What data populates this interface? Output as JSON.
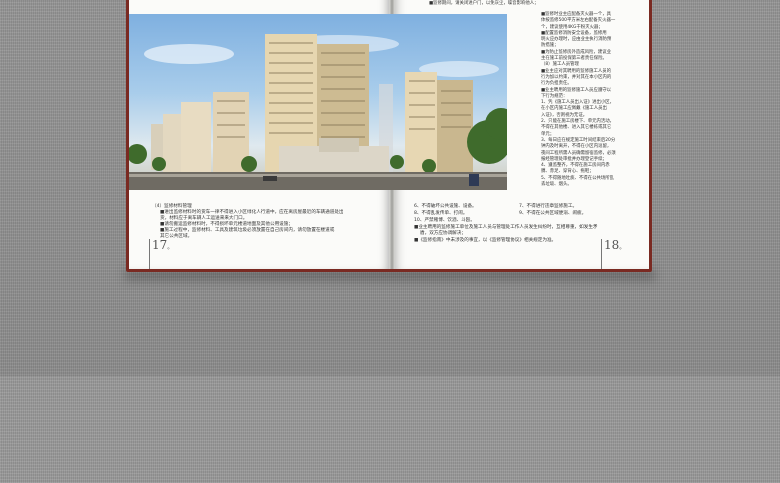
{
  "colors": {
    "cover": "#7a2a22",
    "page": "#fbfbf9",
    "background": "#8e8e8e"
  },
  "photo": {
    "icon": "residential-buildings-rendering"
  },
  "right_top_line": "■监修期间，请关闭进户门，以免灰尘，噪音影响他人；",
  "right_column": [
    "■监修时业主应配备灭火器一个，具",
    "体按监修500平方米左右配备灭火器一",
    "个，建议使用4KG干粉灭火器；",
    "■配置监修消防安全设备，监修用",
    "明火应办理时，应由业主执行消防预",
    "防措施；",
    "■为防止监修房外造成风险，建议业",
    "主在施工前投保第三者责任保险。",
    "（8）施工人员管理",
    "■业主应对其聘用的监修施工人员的",
    "行为加以约束，并对其在本小区内的",
    "行为负担责任。",
    "■业主聘用的监修施工人员应遵守以",
    "下行为规范：",
    "1、凭《施工人员出入证》进出小区，",
    "在小区内施工应佩戴《施工人员出",
    "入证》，否则视为无证。",
    "2、只能在施工房楼下、单元内活动，",
    "不得在其他楼、进入其它楼栋或其它",
    "单元；",
    "3、每日应在规定施工时间结束后20分",
    "钟内及时离开，不得在小区内逗留，",
    "夜间工程所需人员确需留宿监修，必须",
    "报经管理处审批并办理登记手续；",
    "4、遵监整齐，不得在施工房间内赤",
    "膊、赤足、穿背心、拖鞋；",
    "5、不得随地吐痰、不得在公共场所乱",
    "丢垃圾、烟头。"
  ],
  "left_caption": [
    "（4）监修材料管理",
    "■进出监修材料时的货车一律不得进入小区绿化人行道中，应在离房屋最近的车辆通道处出",
    "货，材料应于离车辆人工运送来来大门口。",
    "■请勿搬运监修材料时，不得损坏单元楼道地面及其他公用设施；",
    "■施工过程中，监修材料、工具及建筑垃圾必须放置在自己房间内，请勿放置在楼道或",
    "其它公共区域。"
  ],
  "right_caption_col1": [
    "6、不得破坏公共设施、设备。",
    "8、不得乱发传单、打闹。",
    "10、严禁赌博、饮酒、斗殴。"
  ],
  "right_caption_col2": [
    "7、不得进行违章监修施工。",
    "9、不得在公共区域便溺、闹疲。"
  ],
  "right_caption_notes": [
    "■业主聘用的监修施工单位及施工人员与管理处工作人员发生纠纷时，互相尊重，如发生矛",
    "盾，双方应协调解决；",
    "■《监修指南》中未涉及的事宜，以《监修管理协议》相关规定为准。"
  ],
  "page_left": {
    "number": "17",
    "suffix": "。"
  },
  "page_right": {
    "number": "18",
    "suffix": "。"
  }
}
